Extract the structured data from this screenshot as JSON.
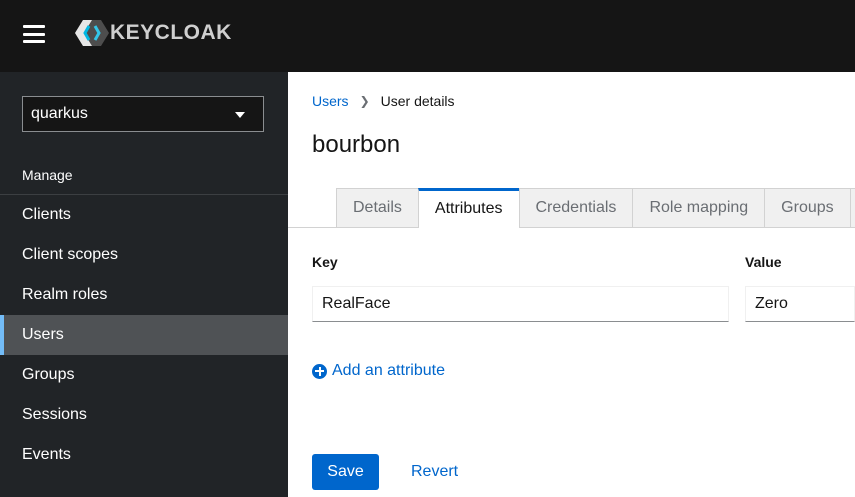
{
  "header": {
    "logo_text": "KEYCLOAK"
  },
  "sidebar": {
    "realm": "quarkus",
    "section_label": "Manage",
    "items": [
      {
        "label": "Clients"
      },
      {
        "label": "Client scopes"
      },
      {
        "label": "Realm roles"
      },
      {
        "label": "Users",
        "active": true
      },
      {
        "label": "Groups"
      },
      {
        "label": "Sessions"
      },
      {
        "label": "Events"
      }
    ]
  },
  "breadcrumb": {
    "parent": "Users",
    "current": "User details"
  },
  "page": {
    "title": "bourbon"
  },
  "tabs": [
    {
      "label": "Details"
    },
    {
      "label": "Attributes",
      "active": true
    },
    {
      "label": "Credentials"
    },
    {
      "label": "Role mapping"
    },
    {
      "label": "Groups"
    }
  ],
  "attributes": {
    "key_label": "Key",
    "value_label": "Value",
    "rows": [
      {
        "key": "RealFace",
        "value": "Zero"
      }
    ],
    "add_label": "Add an attribute"
  },
  "actions": {
    "save": "Save",
    "revert": "Revert"
  },
  "colors": {
    "primary": "#0066cc",
    "masthead": "#151515",
    "sidebar": "#212427",
    "active_nav": "#4f5255",
    "active_nav_accent": "#73bcf7"
  }
}
